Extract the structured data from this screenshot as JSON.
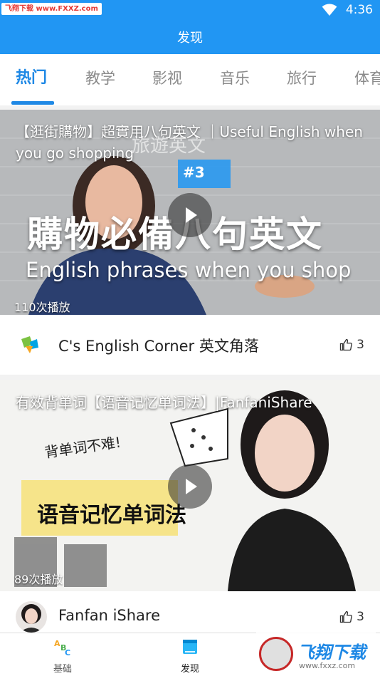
{
  "status_bar": {
    "watermark_text": "飞翔下载 www.FXXZ.com",
    "time": "4:36"
  },
  "header": {
    "title": "发现"
  },
  "tabs": [
    {
      "label": "热门",
      "active": true
    },
    {
      "label": "教学",
      "active": false
    },
    {
      "label": "影视",
      "active": false
    },
    {
      "label": "音乐",
      "active": false
    },
    {
      "label": "旅行",
      "active": false
    },
    {
      "label": "体育",
      "active": false
    }
  ],
  "videos": [
    {
      "title": "【逛街購物】超實用八句英文 ｜Useful English when you go shopping",
      "thumbnail_text": {
        "episode": "#3",
        "headline": "購物必備八句英文",
        "subline": "English phrases when you shop",
        "handwriting": "旅遊英文"
      },
      "views": "110次播放",
      "author": "C's English Corner 英文角落",
      "likes": "3"
    },
    {
      "title": "有效背单词【语音记忆单词法】|FanfaniShare",
      "thumbnail_text": {
        "sticker": "背单词不难!",
        "banner": "语音记忆单词法"
      },
      "views": "89次播放",
      "author": "Fanfan iShare",
      "likes": "3"
    }
  ],
  "bottom_nav": [
    {
      "label": "基础",
      "icon": "abc-icon",
      "active": false
    },
    {
      "label": "发现",
      "icon": "book-icon",
      "active": true
    }
  ],
  "bottom_watermark": {
    "brand": "飞翔下载",
    "url": "www.fxxz.com"
  },
  "colors": {
    "primary": "#2196f3",
    "tab_active": "#1e88e5",
    "tab_inactive": "#8a8a8a"
  }
}
